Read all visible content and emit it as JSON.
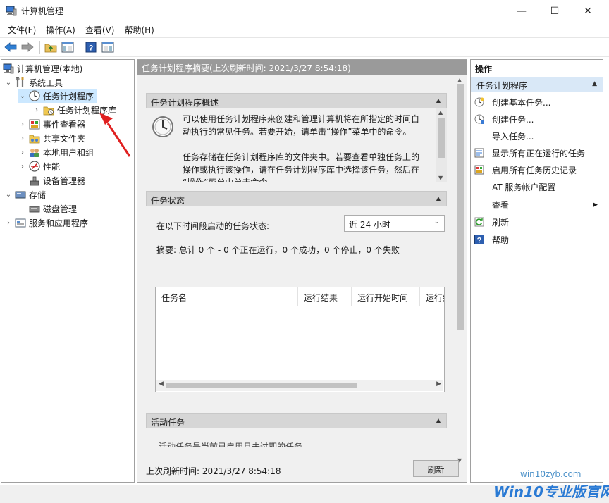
{
  "window": {
    "title": "计算机管理",
    "min_glyph": "—",
    "max_glyph": "☐",
    "close_glyph": "✕"
  },
  "menu": [
    "文件(F)",
    "操作(A)",
    "查看(V)",
    "帮助(H)"
  ],
  "toolbar_icons": [
    "back-arrow-icon",
    "forward-arrow-icon",
    "folder-up-icon",
    "show-hide-tree-icon",
    "help-icon",
    "show-hide-action-pane-icon"
  ],
  "tree": {
    "root": "计算机管理(本地)",
    "system_tools": "系统工具",
    "task_scheduler": "任务计划程序",
    "task_scheduler_library": "任务计划程序库",
    "event_viewer": "事件查看器",
    "shared_folders": "共享文件夹",
    "local_users": "本地用户和组",
    "performance": "性能",
    "device_manager": "设备管理器",
    "storage": "存储",
    "disk_management": "磁盘管理",
    "services_apps": "服务和应用程序"
  },
  "center": {
    "header": "任务计划程序摘要(上次刷新时间: 2021/3/27 8:54:18)",
    "overview": {
      "title": "任务计划程序概述",
      "line1": "可以使用任务计划程序来创建和管理计算机将在所指定的时间自",
      "line2": "动执行的常见任务。若要开始，请单击“操作”菜单中的命令。",
      "line3": "任务存储在任务计划程序库的文件夹中。若要查看单独任务上的",
      "line4": "操作或执行该操作，请在任务计划程序库中选择该任务，然后在",
      "line5": "“操作”菜单中单击命令。"
    },
    "status": {
      "title": "任务状态",
      "period_label": "在以下时间段启动的任务状态:",
      "period_value": "近 24 小时",
      "summary": "摘要: 总计 0 个 - 0 个正在运行，0 个成功，0 个停止，0 个失败",
      "columns": [
        "任务名",
        "运行结果",
        "运行开始时间",
        "运行结"
      ]
    },
    "active": {
      "title": "活动任务",
      "text": "活动任务是当前已启用且未过期的任务。"
    },
    "footer": {
      "last_refresh": "上次刷新时间: 2021/3/27 8:54:18",
      "refresh_button": "刷新"
    }
  },
  "actions": {
    "header": "操作",
    "section": "任务计划程序",
    "items": [
      {
        "label": "创建基本任务...",
        "icon": "create-basic-task-icon"
      },
      {
        "label": "创建任务...",
        "icon": "create-task-icon"
      },
      {
        "label": "导入任务...",
        "icon": ""
      },
      {
        "label": "显示所有正在运行的任务",
        "icon": "running-tasks-icon"
      },
      {
        "label": "启用所有任务历史记录",
        "icon": "history-icon"
      },
      {
        "label": "AT 服务帐户配置",
        "icon": ""
      },
      {
        "label": "查看",
        "icon": ""
      },
      {
        "label": "刷新",
        "icon": "refresh-icon"
      },
      {
        "label": "帮助",
        "icon": "help-icon"
      }
    ]
  },
  "watermark": {
    "url": "win10zyb.com",
    "brand": "Win10专业版官网"
  },
  "colors": {
    "selected": "#cce8ff",
    "header_gray": "#9a9a9a",
    "actions_section": "#d9e8f7",
    "annotation_red": "#e02020",
    "watermark_blue": "#2a7ad4"
  }
}
